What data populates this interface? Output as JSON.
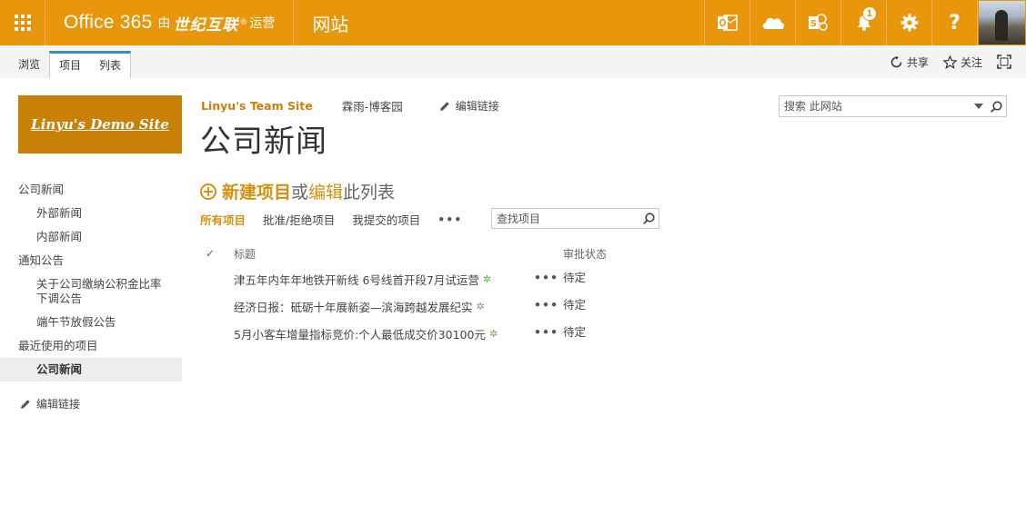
{
  "suitebar": {
    "brand_office": "Office 365",
    "brand_by": "由",
    "brand_corp": "世纪互联",
    "brand_sup": "®",
    "brand_operated": "运营",
    "section_title": "网站",
    "notification_count": "1",
    "help_label": "?",
    "accent_color": "#e8960c"
  },
  "ribbon": {
    "tabs": [
      "浏览",
      "项目",
      "列表"
    ],
    "share_label": "共享",
    "follow_label": "关注"
  },
  "site_logo_text": "Linyu's Demo Site",
  "breadcrumbs": {
    "site": "Linyu's Team Site",
    "link": "霖雨-博客园",
    "edit_links": "编辑链接"
  },
  "page_title": "公司新闻",
  "search_site": {
    "placeholder": "搜索 此网站"
  },
  "leftnav": {
    "items": [
      {
        "label": "公司新闻"
      },
      {
        "label": "外部新闻"
      },
      {
        "label": "内部新闻"
      },
      {
        "label": "通知公告"
      },
      {
        "label": "关于公司缴纳公积金比率下调公告"
      },
      {
        "label": "端午节放假公告"
      },
      {
        "label": "最近使用的项目"
      },
      {
        "label": "公司新闻"
      }
    ],
    "edit_links": "编辑链接"
  },
  "new_item": {
    "new_label": "新建项目",
    "or_label": "或",
    "edit_label": "编辑",
    "rest_label": "此列表"
  },
  "views": {
    "items": [
      "所有项目",
      "批准/拒绝项目",
      "我提交的项目"
    ],
    "more": "•••",
    "find_placeholder": "查找项目"
  },
  "list": {
    "headers": {
      "check": "✓",
      "title": "标题",
      "status": "审批状态"
    },
    "rows": [
      {
        "title": "津五年内年年地铁开新线 6号线首开段7月试运营",
        "new_mark": "✲",
        "more": "•••",
        "status": "待定"
      },
      {
        "title": "经济日报：砥砺十年展新姿—滨海跨越发展纪实",
        "new_mark": "✲",
        "more": "•••",
        "status": "待定"
      },
      {
        "title": "5月小客车增量指标竞价:个人最低成交价30100元",
        "new_mark": "✲",
        "more": "•••",
        "status": "待定"
      }
    ]
  }
}
